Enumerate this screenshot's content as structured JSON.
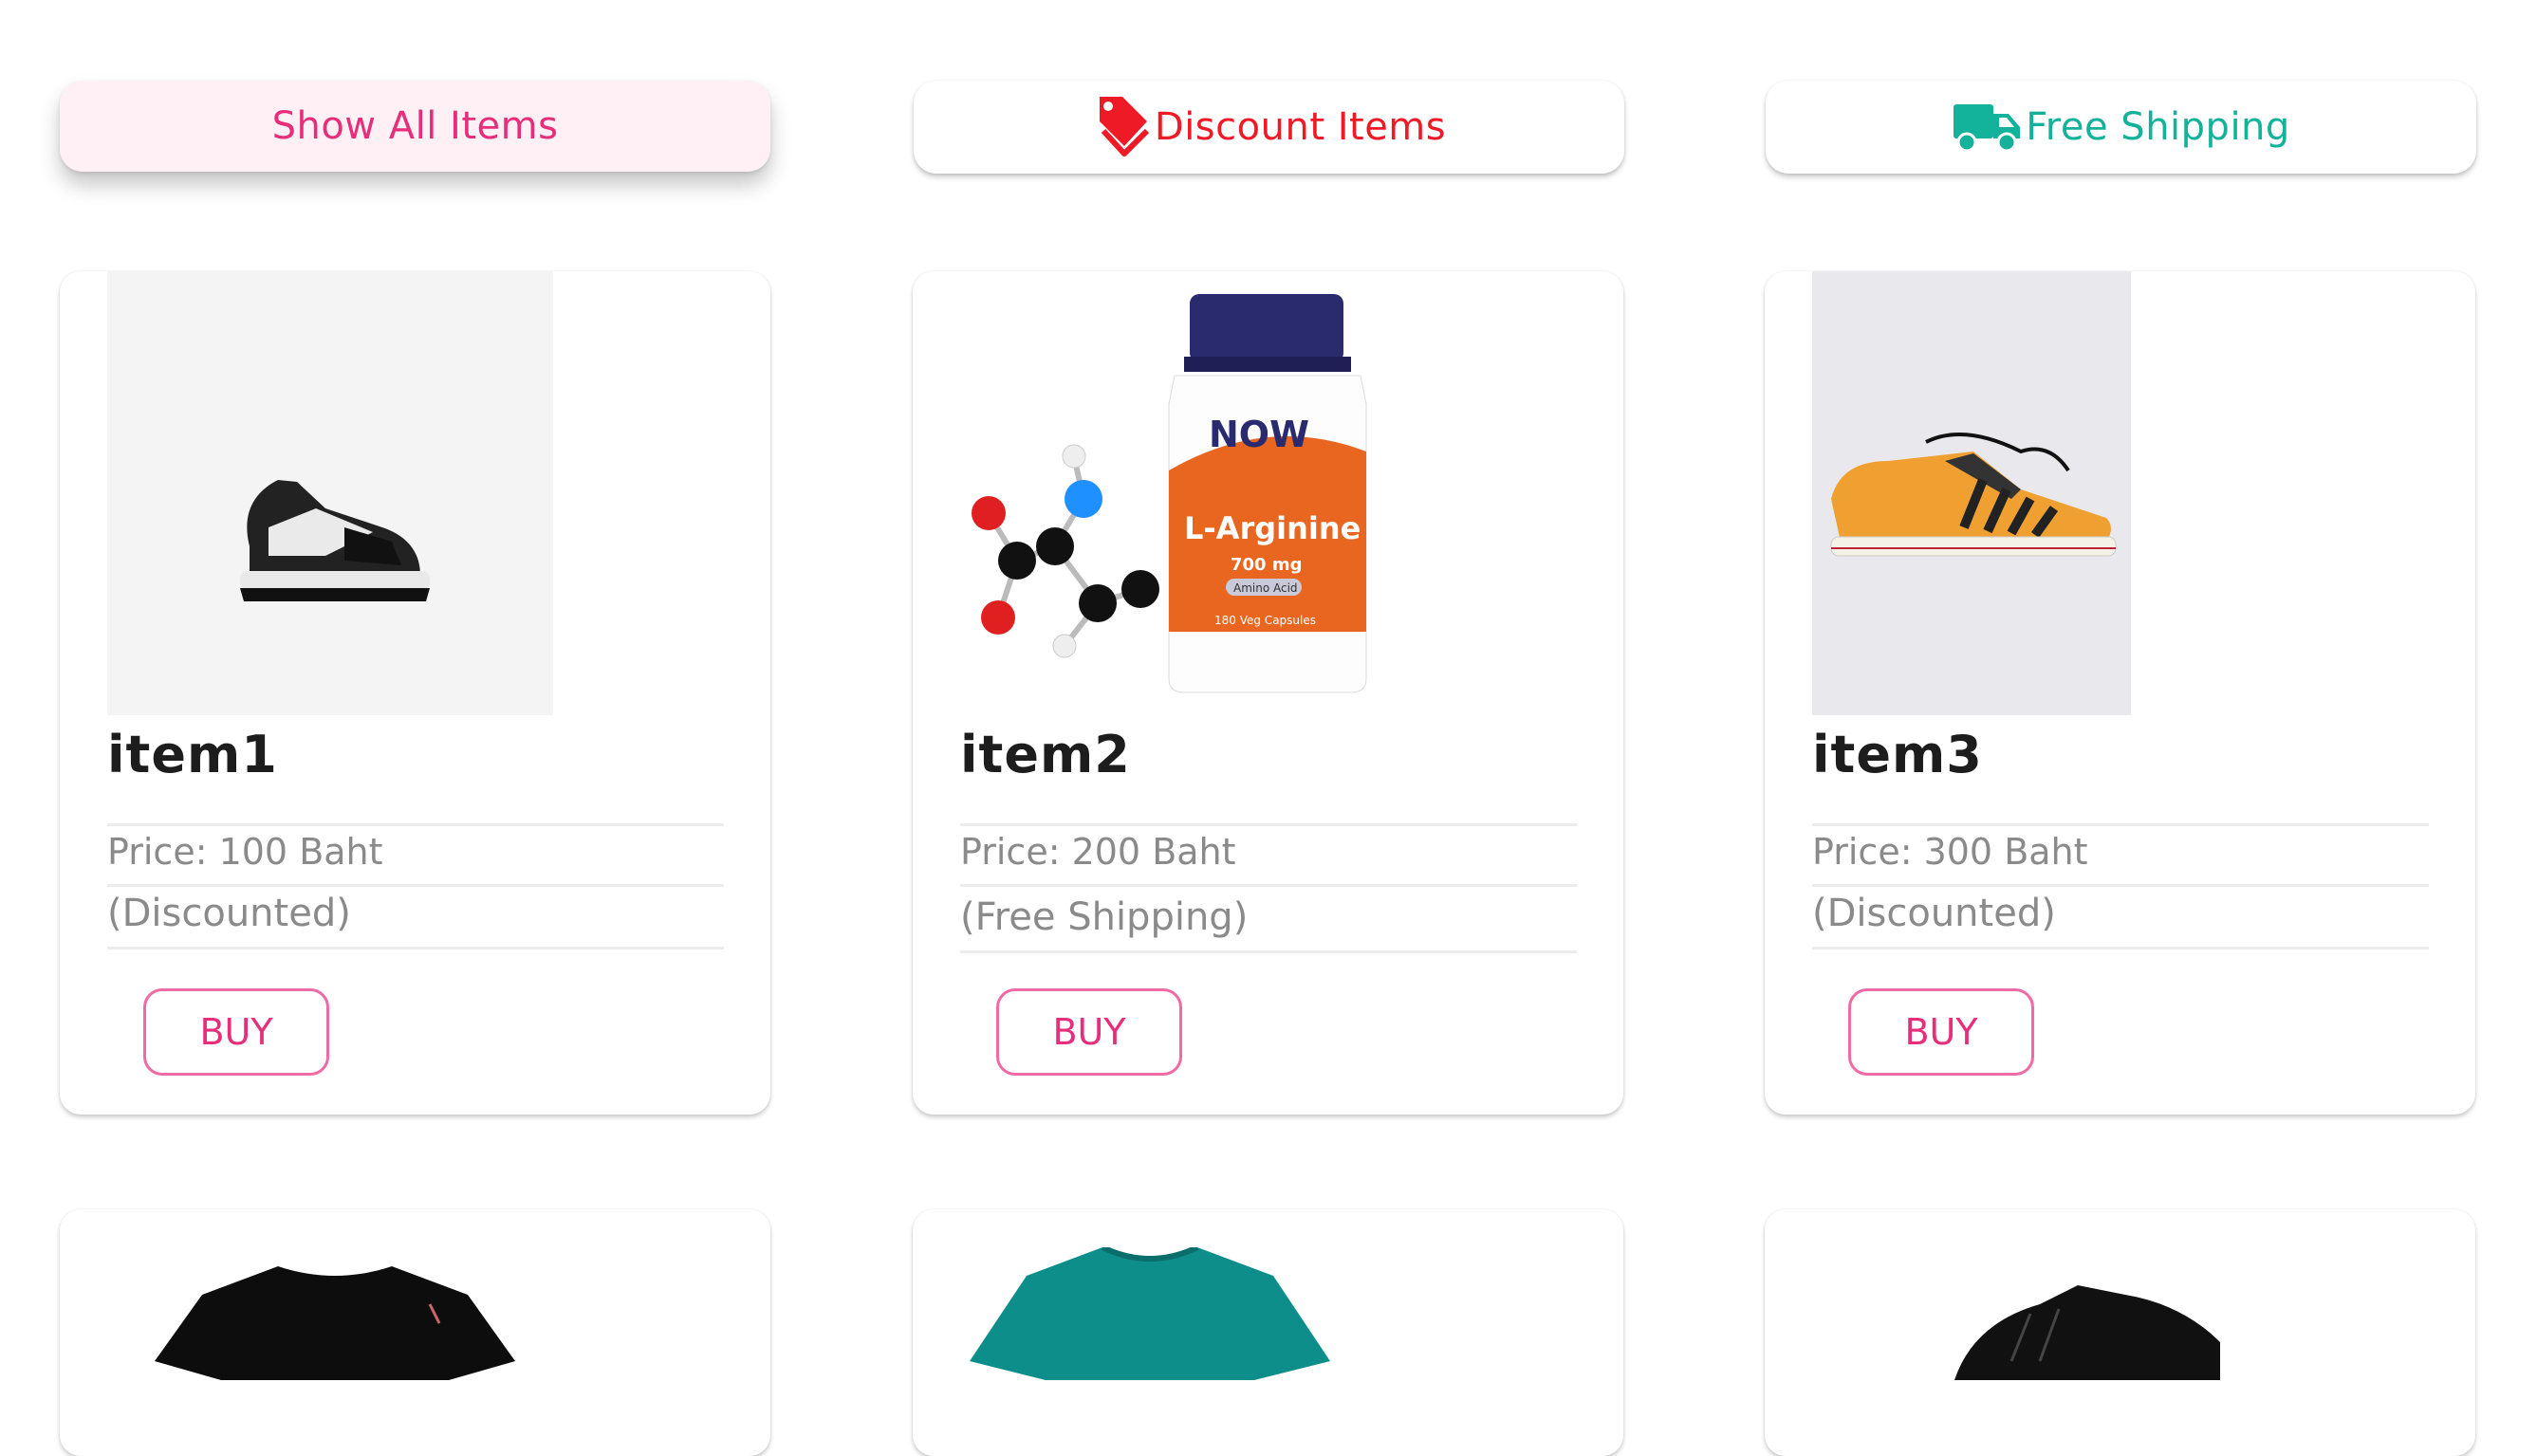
{
  "filters": {
    "show_all": "Show All Items",
    "discount": "Discount Items",
    "free_shipping": "Free Shipping",
    "discount_icon": "tag-icon",
    "shipping_icon": "truck-icon",
    "colors": {
      "accent_pink": "#e62e7a",
      "discount_red": "#ee1a26",
      "shipping_green": "#13b29a"
    }
  },
  "products": [
    {
      "name": "item1",
      "price": "Price: 100 Baht",
      "note": "(Discounted)",
      "buy": "BUY",
      "image": "sneaker"
    },
    {
      "name": "item2",
      "price": "Price: 200 Baht",
      "note": "(Free Shipping)",
      "buy": "BUY",
      "image": "supplement-bottle",
      "label": {
        "brand": "NOW",
        "title": "L-Arginine",
        "dose": "700 mg",
        "tag": "Amino Acid",
        "count": "180 Veg Capsules"
      }
    },
    {
      "name": "item3",
      "price": "Price: 300 Baht",
      "note": "(Discounted)",
      "buy": "BUY",
      "image": "canvas-shoe"
    }
  ],
  "more_products": [
    {
      "image": "black-tshirt"
    },
    {
      "image": "teal-tshirt"
    },
    {
      "image": "black-sneaker"
    }
  ]
}
